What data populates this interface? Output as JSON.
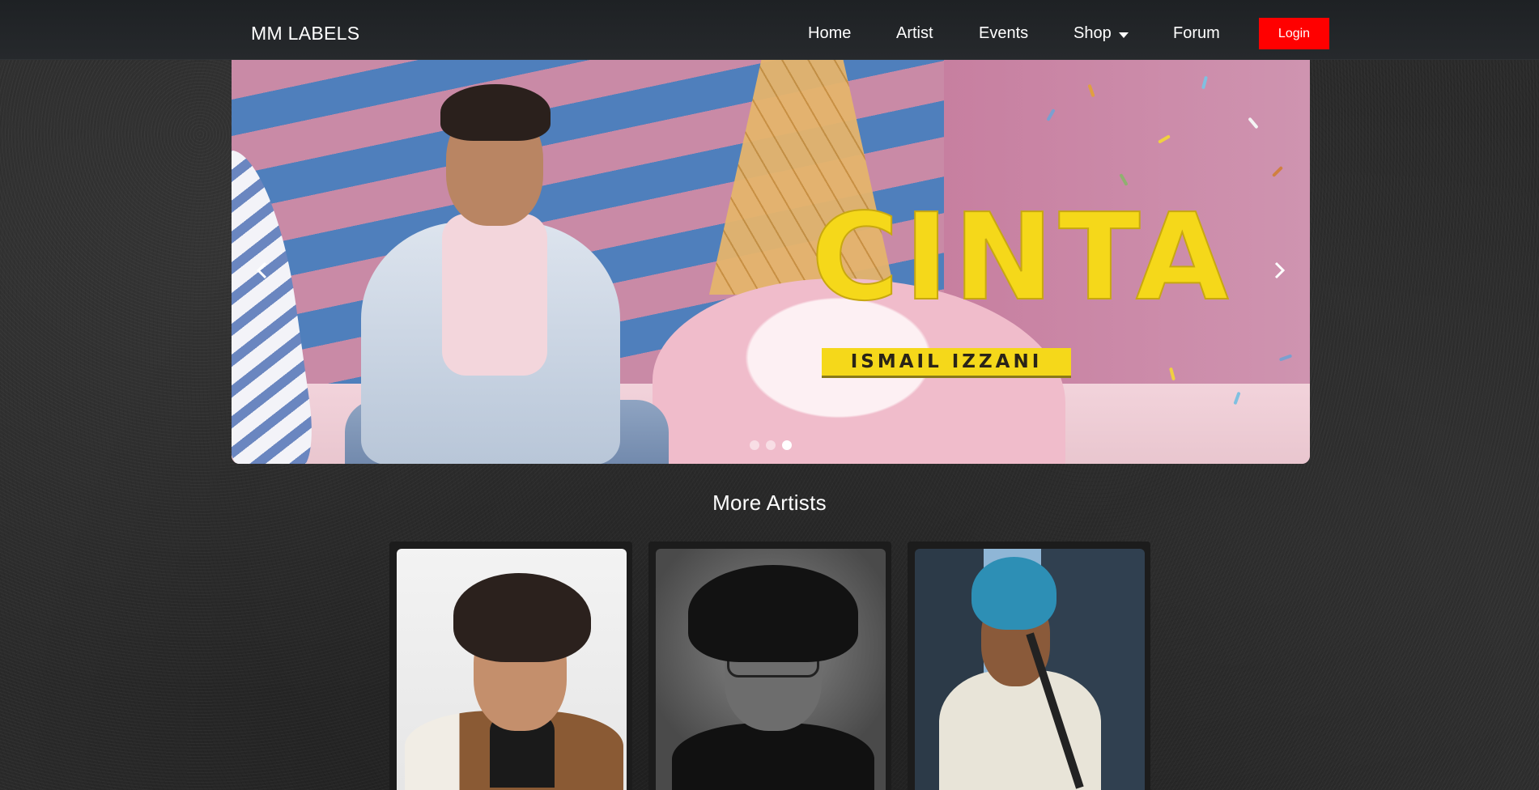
{
  "navbar": {
    "brand": "MM LABELS",
    "links": {
      "home": "Home",
      "artist": "Artist",
      "events": "Events",
      "shop": "Shop",
      "forum": "Forum"
    },
    "login_label": "Login",
    "login_color": "#ff0000"
  },
  "carousel": {
    "slide_title": "CINTA",
    "slide_subtitle": "ISMAIL IZZANI",
    "indicator_count": 3,
    "active_indicator": 3,
    "title_color": "#f5d81a"
  },
  "more_artists": {
    "title": "More Artists",
    "cards": [
      {
        "photo": "artist-1-photo"
      },
      {
        "photo": "artist-2-photo"
      },
      {
        "photo": "artist-3-photo"
      }
    ]
  },
  "icons": {
    "prev": "chevron-left-icon",
    "next": "chevron-right-icon",
    "shop_dropdown": "caret-down-icon"
  }
}
